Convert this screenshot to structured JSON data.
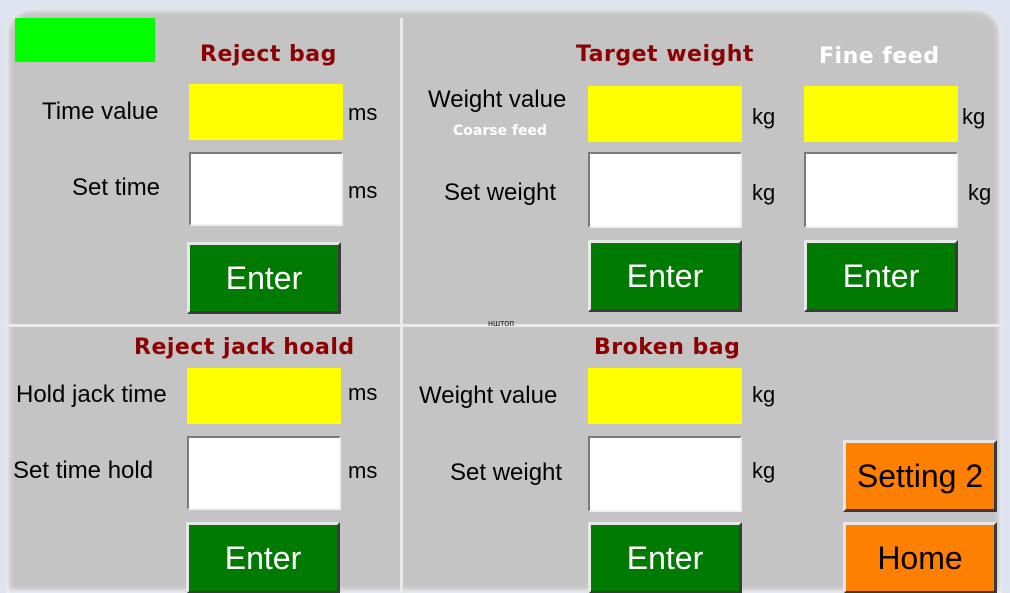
{
  "reject_bag": {
    "title": "Reject bag",
    "time_value_label": "Time value",
    "set_time_label": "Set time",
    "unit": "ms",
    "enter_label": "Enter"
  },
  "target_weight": {
    "title": "Target weight",
    "coarse_feed_label": "Coarse feed",
    "weight_value_label": "Weight value",
    "set_weight_label": "Set weight",
    "unit": "kg",
    "enter_label": "Enter"
  },
  "fine_feed": {
    "title": "Fine feed",
    "unit": "kg",
    "enter_label": "Enter"
  },
  "reject_jack_hold": {
    "title": "Reject jack hoald",
    "hold_jack_time_label": "Hold jack time",
    "set_time_hold_label": "Set time hold",
    "unit": "ms",
    "enter_label": "Enter"
  },
  "broken_bag": {
    "title": "Broken bag",
    "weight_value_label": "Weight value",
    "set_weight_label": "Set weight",
    "unit": "kg",
    "enter_label": "Enter"
  },
  "nav": {
    "setting2_label": "Setting 2",
    "home_label": "Home"
  },
  "stray_text": "нштоп",
  "colors": {
    "status": "#00ff00",
    "value_field": "#ffff00",
    "enter_button": "#007a00",
    "nav_button": "#ff7f00",
    "title": "#8b0000"
  }
}
